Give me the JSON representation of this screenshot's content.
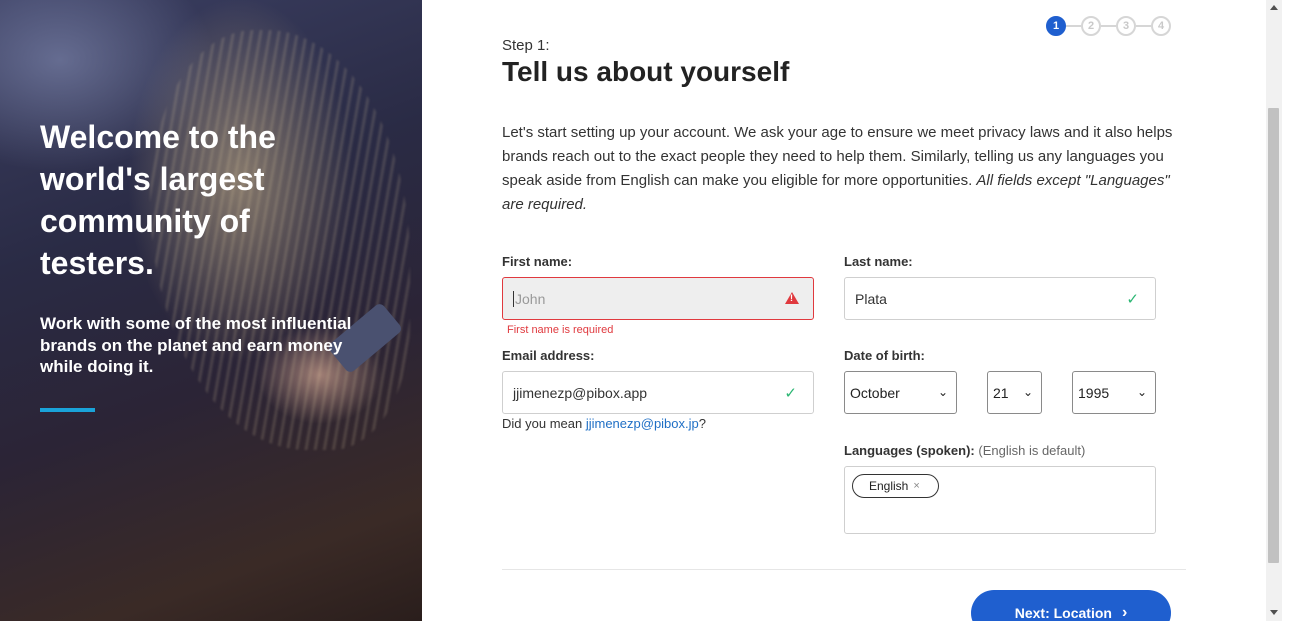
{
  "hero": {
    "title": "Welcome to the world's largest community of testers.",
    "subtitle": "Work with some of the most influential brands on the planet and earn money while doing it.",
    "accent_color": "#1aa3d9"
  },
  "stepper": {
    "steps": [
      "1",
      "2",
      "3",
      "4"
    ],
    "current": 1,
    "active_color": "#1f5fcf"
  },
  "header": {
    "step_label": "Step 1:",
    "title": "Tell us about yourself"
  },
  "intro": {
    "text": "Let's start setting up your account. We ask your age to ensure we meet privacy laws and it also helps brands reach out to the exact people they need to help them. Similarly, telling us any languages you speak aside from English can make you eligible for more opportunities. ",
    "italic": "All fields except \"Languages\" are required."
  },
  "form": {
    "first_name": {
      "label": "First name:",
      "value": "",
      "placeholder": "John",
      "error": "First name is required",
      "status_icon": "warning-icon"
    },
    "last_name": {
      "label": "Last name:",
      "value": "Plata",
      "status_icon": "check-icon"
    },
    "email": {
      "label": "Email address:",
      "value": "jjimenezp@pibox.app",
      "status_icon": "check-icon",
      "suggest_prefix": "Did you mean ",
      "suggest_link": "jjimenezp@pibox.jp",
      "suggest_suffix": "?"
    },
    "dob": {
      "label": "Date of birth:",
      "month": "October",
      "day": "21",
      "year": "1995"
    },
    "languages": {
      "label": "Languages (spoken):",
      "hint": "(English is default)",
      "chips": [
        "English"
      ]
    }
  },
  "actions": {
    "next_label": "Next: Location"
  },
  "colors": {
    "error": "#e0393e",
    "success": "#2bb673",
    "primary": "#1f5fcf"
  }
}
